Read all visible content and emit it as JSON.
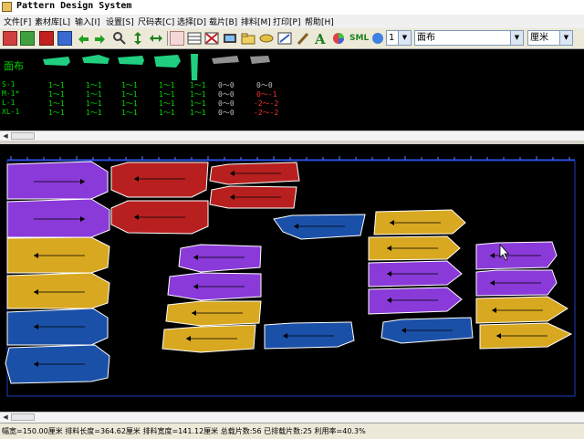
{
  "window": {
    "title": "Pattern Design System"
  },
  "menu": [
    "文件[F]",
    "素材库[L]",
    "输入[I]",
    "设置[S]",
    "尺码表[C]",
    "选择[D]",
    "载片[B]",
    "排料[M]",
    "打印[P]",
    "帮助[H]"
  ],
  "toolbar": {
    "layer_value": "1",
    "fabric_value": "面布",
    "unit_value": "厘米",
    "sml_label": "SML"
  },
  "colors": {
    "purple": "#8a3ad8",
    "red": "#b82020",
    "blue": "#1a50a8",
    "yellow": "#d8a820",
    "green": "#00d800"
  },
  "piece_summary": {
    "fabric": "面布",
    "rows": [
      {
        "size": "S-1",
        "cells": [
          "1～1",
          "1～1",
          "1～1",
          "1～1",
          "1～1",
          "0～0",
          "0～0"
        ]
      },
      {
        "size": "M-1*",
        "cells": [
          "1～1",
          "1～1",
          "1～1",
          "1～1",
          "1～1",
          "0～0",
          "0～-1"
        ]
      },
      {
        "size": "L-1",
        "cells": [
          "1～1",
          "1～1",
          "1～1",
          "1～1",
          "1～1",
          "0～0",
          "-2～-2"
        ]
      },
      {
        "size": "XL-1",
        "cells": [
          "1～1",
          "1～1",
          "1～1",
          "1～1",
          "1～1",
          "0～0",
          "-2～-2"
        ]
      }
    ]
  },
  "status": {
    "text": "幅宽=150.00厘米  排料长度=364.62厘米  排料宽度=141.12厘米  总载片数:56  已排载片数:25  利用率=40.3%"
  }
}
